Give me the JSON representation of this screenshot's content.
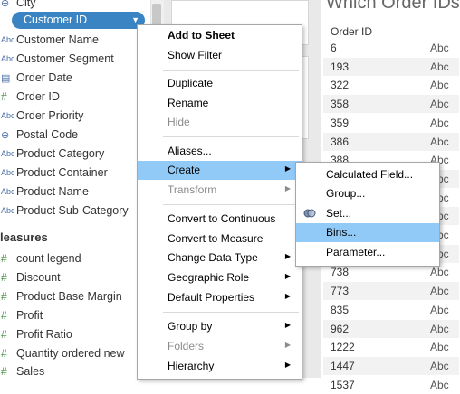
{
  "data_pane": {
    "dimensions": [
      {
        "icon": "geo",
        "label": "City"
      },
      {
        "icon": "abc",
        "label": "Customer ID",
        "selected": true
      },
      {
        "icon": "abc",
        "label": "Customer Name"
      },
      {
        "icon": "abc",
        "label": "Customer Segment"
      },
      {
        "icon": "date",
        "label": "Order Date"
      },
      {
        "icon": "hash",
        "label": "Order ID"
      },
      {
        "icon": "abc",
        "label": "Order Priority"
      },
      {
        "icon": "geo",
        "label": "Postal Code"
      },
      {
        "icon": "abc",
        "label": "Product Category"
      },
      {
        "icon": "abc",
        "label": "Product Container"
      },
      {
        "icon": "abc",
        "label": "Product Name"
      },
      {
        "icon": "abc",
        "label": "Product Sub-Category"
      }
    ],
    "measures_title": "leasures",
    "measures": [
      {
        "icon": "hash",
        "label": "count legend"
      },
      {
        "icon": "hash",
        "label": "Discount"
      },
      {
        "icon": "hash",
        "label": "Product Base Margin"
      },
      {
        "icon": "hash",
        "label": "Profit"
      },
      {
        "icon": "hash",
        "label": "Profit Ratio"
      },
      {
        "icon": "hash",
        "label": "Quantity ordered new"
      },
      {
        "icon": "hash",
        "label": "Sales"
      }
    ],
    "icon_glyphs": {
      "abc": "Abc",
      "geo": "⊕",
      "date": "▤",
      "hash": "#"
    }
  },
  "view": {
    "title": "Which Order IDs",
    "column_header": "Order ID",
    "abc_label": "Abc",
    "rows": [
      "6",
      "193",
      "322",
      "358",
      "359",
      "386",
      "388",
      "",
      "",
      "",
      "",
      "",
      "738",
      "773",
      "835",
      "962",
      "1222",
      "1447",
      "1537"
    ]
  },
  "context_menu": {
    "items": [
      {
        "label": "Add to Sheet",
        "bold": true
      },
      {
        "label": "Show Filter"
      },
      {
        "label": "Duplicate"
      },
      {
        "label": "Rename"
      },
      {
        "label": "Hide",
        "disabled": true
      },
      {
        "label": "Aliases..."
      },
      {
        "label": "Create",
        "submenu": true,
        "highlighted": true
      },
      {
        "label": "Transform",
        "submenu": true,
        "disabled": true
      },
      {
        "label": "Convert to Continuous"
      },
      {
        "label": "Convert to Measure"
      },
      {
        "label": "Change Data Type",
        "submenu": true
      },
      {
        "label": "Geographic Role",
        "submenu": true
      },
      {
        "label": "Default Properties",
        "submenu": true
      },
      {
        "label": "Group by",
        "submenu": true
      },
      {
        "label": "Folders",
        "submenu": true,
        "disabled": true
      },
      {
        "label": "Hierarchy",
        "submenu": true
      }
    ]
  },
  "submenu": {
    "items": [
      {
        "label": "Calculated Field..."
      },
      {
        "label": "Group..."
      },
      {
        "label": "Set...",
        "icon": "set-icon"
      },
      {
        "label": "Bins...",
        "highlighted": true
      },
      {
        "label": "Parameter..."
      }
    ]
  },
  "colors": {
    "selection_pill": "#3a84c4",
    "menu_highlight": "#91c9f7",
    "measure_icon": "#3c8a3c",
    "dimension_icon": "#4b6fa8"
  }
}
